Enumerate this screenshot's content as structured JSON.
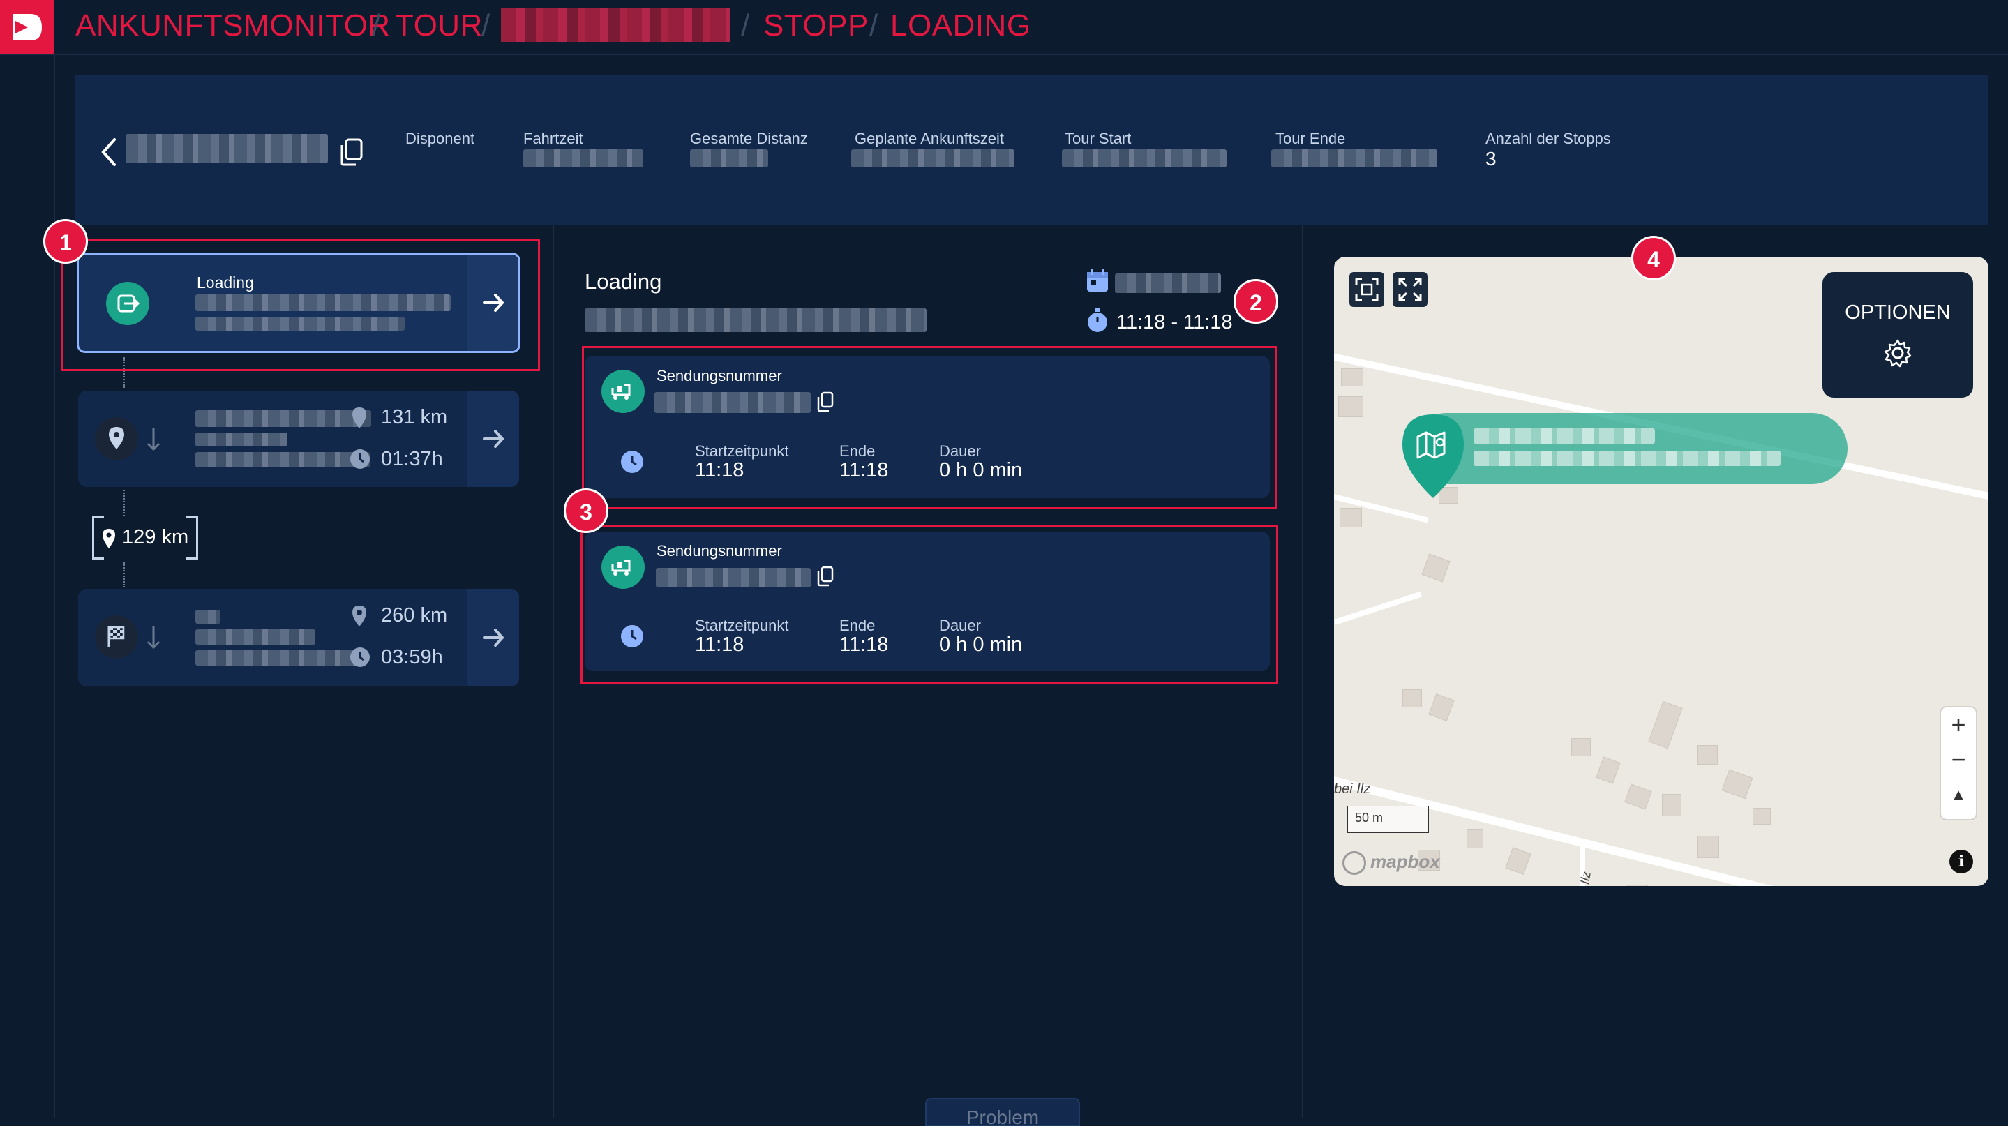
{
  "breadcrumb": {
    "items": [
      "ANKUNFTSMONITOR",
      "TOUR",
      "STOPP",
      "LOADING"
    ],
    "separator": "/"
  },
  "header": {
    "fields": [
      {
        "label": "Disponent"
      },
      {
        "label": "Fahrtzeit"
      },
      {
        "label": "Gesamte Distanz"
      },
      {
        "label": "Geplante Ankunftszeit"
      },
      {
        "label": "Tour Start"
      },
      {
        "label": "Tour Ende"
      },
      {
        "label": "Anzahl der Stopps",
        "value": "3"
      }
    ]
  },
  "stops": [
    {
      "title": "Loading",
      "type": "loading"
    },
    {
      "distance": "131 km",
      "duration": "01:37h",
      "type": "waypoint"
    },
    {
      "distance": "260 km",
      "duration": "03:59h",
      "type": "finish"
    }
  ],
  "leg_distance": "129 km",
  "detail": {
    "title": "Loading",
    "time_range": "11:18 - 11:18"
  },
  "shipments": [
    {
      "label": "Sendungsnummer",
      "start_label": "Startzeitpunkt",
      "start": "11:18",
      "end_label": "Ende",
      "end": "11:18",
      "duration_label": "Dauer",
      "duration": "0 h 0 min"
    },
    {
      "label": "Sendungsnummer",
      "start_label": "Startzeitpunkt",
      "start": "11:18",
      "end_label": "Ende",
      "end": "11:18",
      "duration_label": "Dauer",
      "duration": "0 h 0 min"
    }
  ],
  "map": {
    "options_label": "OPTIONEN",
    "scale_label": "50 m",
    "attribution": "mapbox",
    "place_label": "bei Ilz",
    "road_label": "Ilz"
  },
  "annotations": [
    "1",
    "2",
    "3",
    "4"
  ],
  "bottom_button": "Problem",
  "colors": {
    "accent": "#e3173f",
    "teal": "#1aa58a",
    "background": "#0d1b2e",
    "panel": "#11284a"
  }
}
